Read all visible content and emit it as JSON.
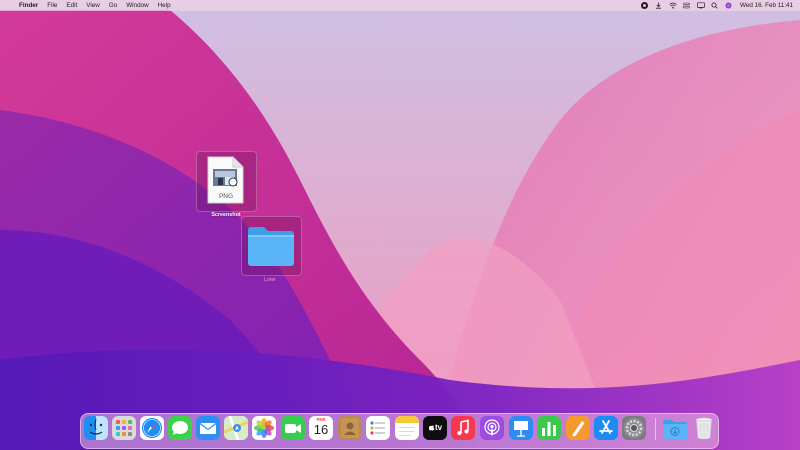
{
  "menubar": {
    "apple_glyph": "",
    "app_name": "Finder",
    "menus": [
      "File",
      "Edit",
      "View",
      "Go",
      "Window",
      "Help"
    ],
    "status_icons": [
      "screen-record-icon",
      "download-icon",
      "wifi-icon",
      "control-center-icon",
      "display-icon",
      "search-icon",
      "siri-icon"
    ],
    "clock": "Wed 16. Feb  11:41"
  },
  "desktop": {
    "screenshot_file": {
      "label": "Screenshot",
      "badge": "PNG"
    },
    "folder_ghost_label": "Lorer"
  },
  "dock": {
    "calendar": {
      "month": "FEB",
      "day": "16"
    },
    "tv_label": "tv",
    "items": [
      "Finder",
      "Launchpad",
      "Safari",
      "Messages",
      "Mail",
      "Maps",
      "Photos",
      "FaceTime",
      "Calendar",
      "Contacts",
      "Reminders",
      "Notes",
      "TV",
      "Music",
      "Podcasts",
      "Keynote",
      "Numbers",
      "Pages",
      "App Store",
      "System Preferences",
      "Downloads",
      "Trash"
    ]
  },
  "colors": {
    "wallpaper_top": "#d7c7e6",
    "wallpaper_magenta": "#c2288e",
    "wallpaper_purple": "#6a1bb8",
    "wallpaper_pink": "#f08ab4"
  }
}
